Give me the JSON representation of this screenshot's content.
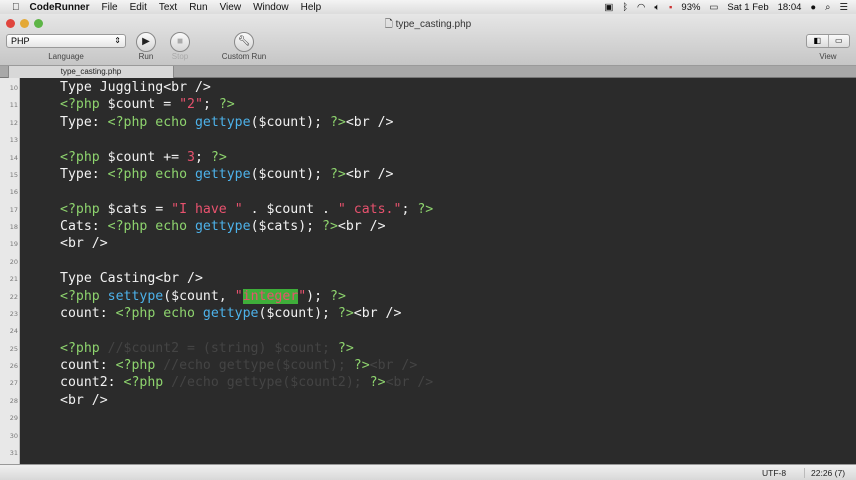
{
  "menubar": {
    "app": "CodeRunner",
    "items": [
      "File",
      "Edit",
      "Text",
      "Run",
      "View",
      "Window",
      "Help"
    ],
    "battery": "93%",
    "date": "Sat 1 Feb",
    "time": "18:04"
  },
  "window": {
    "title": "type_casting.php"
  },
  "toolbar": {
    "language_value": "PHP",
    "language_label": "Language",
    "run_label": "Run",
    "stop_label": "Stop",
    "custom_run_label": "Custom Run",
    "view_label": "View"
  },
  "tabs": [
    {
      "label": "type_casting.php"
    }
  ],
  "editor": {
    "lines": [
      {
        "n": "10",
        "tokens": [
          [
            "txt",
            "Type Juggling<br />"
          ]
        ]
      },
      {
        "n": "11",
        "tokens": [
          [
            "php",
            "<?php "
          ],
          [
            "txt",
            "$count = "
          ],
          [
            "str",
            "\"2\""
          ],
          [
            "txt",
            "; "
          ],
          [
            "php",
            "?>"
          ]
        ]
      },
      {
        "n": "12",
        "tokens": [
          [
            "txt",
            "Type: "
          ],
          [
            "php",
            "<?php echo "
          ],
          [
            "fn",
            "gettype"
          ],
          [
            "txt",
            "($count); "
          ],
          [
            "php",
            "?>"
          ],
          [
            "txt",
            "<br />"
          ]
        ]
      },
      {
        "n": "13",
        "tokens": []
      },
      {
        "n": "14",
        "tokens": [
          [
            "php",
            "<?php "
          ],
          [
            "txt",
            "$count += "
          ],
          [
            "str",
            "3"
          ],
          [
            "txt",
            "; "
          ],
          [
            "php",
            "?>"
          ]
        ]
      },
      {
        "n": "15",
        "tokens": [
          [
            "txt",
            "Type: "
          ],
          [
            "php",
            "<?php echo "
          ],
          [
            "fn",
            "gettype"
          ],
          [
            "txt",
            "($count); "
          ],
          [
            "php",
            "?>"
          ],
          [
            "txt",
            "<br />"
          ]
        ]
      },
      {
        "n": "16",
        "tokens": []
      },
      {
        "n": "17",
        "tokens": [
          [
            "php",
            "<?php "
          ],
          [
            "txt",
            "$cats = "
          ],
          [
            "str",
            "\"I have \""
          ],
          [
            "txt",
            " . $count . "
          ],
          [
            "str",
            "\" cats.\""
          ],
          [
            "txt",
            "; "
          ],
          [
            "php",
            "?>"
          ]
        ]
      },
      {
        "n": "18",
        "tokens": [
          [
            "txt",
            "Cats: "
          ],
          [
            "php",
            "<?php echo "
          ],
          [
            "fn",
            "gettype"
          ],
          [
            "txt",
            "($cats); "
          ],
          [
            "php",
            "?>"
          ],
          [
            "txt",
            "<br />"
          ]
        ]
      },
      {
        "n": "19",
        "tokens": [
          [
            "txt",
            "<br />"
          ]
        ]
      },
      {
        "n": "20",
        "tokens": []
      },
      {
        "n": "21",
        "tokens": [
          [
            "txt",
            "Type Casting<br />"
          ]
        ]
      },
      {
        "n": "22",
        "tokens": [
          [
            "php",
            "<?php "
          ],
          [
            "fn",
            "settype"
          ],
          [
            "txt",
            "($count, "
          ],
          [
            "str",
            "\""
          ],
          [
            "hl",
            "integer"
          ],
          [
            "str",
            "\""
          ],
          [
            "txt",
            "); "
          ],
          [
            "php",
            "?>"
          ]
        ]
      },
      {
        "n": "23",
        "tokens": [
          [
            "txt",
            "count: "
          ],
          [
            "php",
            "<?php echo "
          ],
          [
            "fn",
            "gettype"
          ],
          [
            "txt",
            "($count); "
          ],
          [
            "php",
            "?>"
          ],
          [
            "txt",
            "<br />"
          ]
        ]
      },
      {
        "n": "24",
        "tokens": []
      },
      {
        "n": "25",
        "tokens": [
          [
            "php",
            "<?php "
          ],
          [
            "com",
            "//$count2 = (string) $count; "
          ],
          [
            "php",
            "?>"
          ]
        ]
      },
      {
        "n": "26",
        "tokens": [
          [
            "txt",
            "count: "
          ],
          [
            "php",
            "<?php "
          ],
          [
            "com",
            "//echo gettype($count); "
          ],
          [
            "php",
            "?>"
          ],
          [
            "com",
            "<br />"
          ]
        ]
      },
      {
        "n": "27",
        "tokens": [
          [
            "txt",
            "count2: "
          ],
          [
            "php",
            "<?php "
          ],
          [
            "com",
            "//echo gettype($count2); "
          ],
          [
            "php",
            "?>"
          ],
          [
            "com",
            "<br />"
          ]
        ]
      },
      {
        "n": "28",
        "tokens": [
          [
            "txt",
            "<br />"
          ]
        ]
      },
      {
        "n": "29",
        "tokens": []
      },
      {
        "n": "30",
        "tokens": []
      },
      {
        "n": "31",
        "tokens": []
      }
    ]
  },
  "status": {
    "encoding": "UTF-8",
    "position": "22:26 (7)"
  }
}
